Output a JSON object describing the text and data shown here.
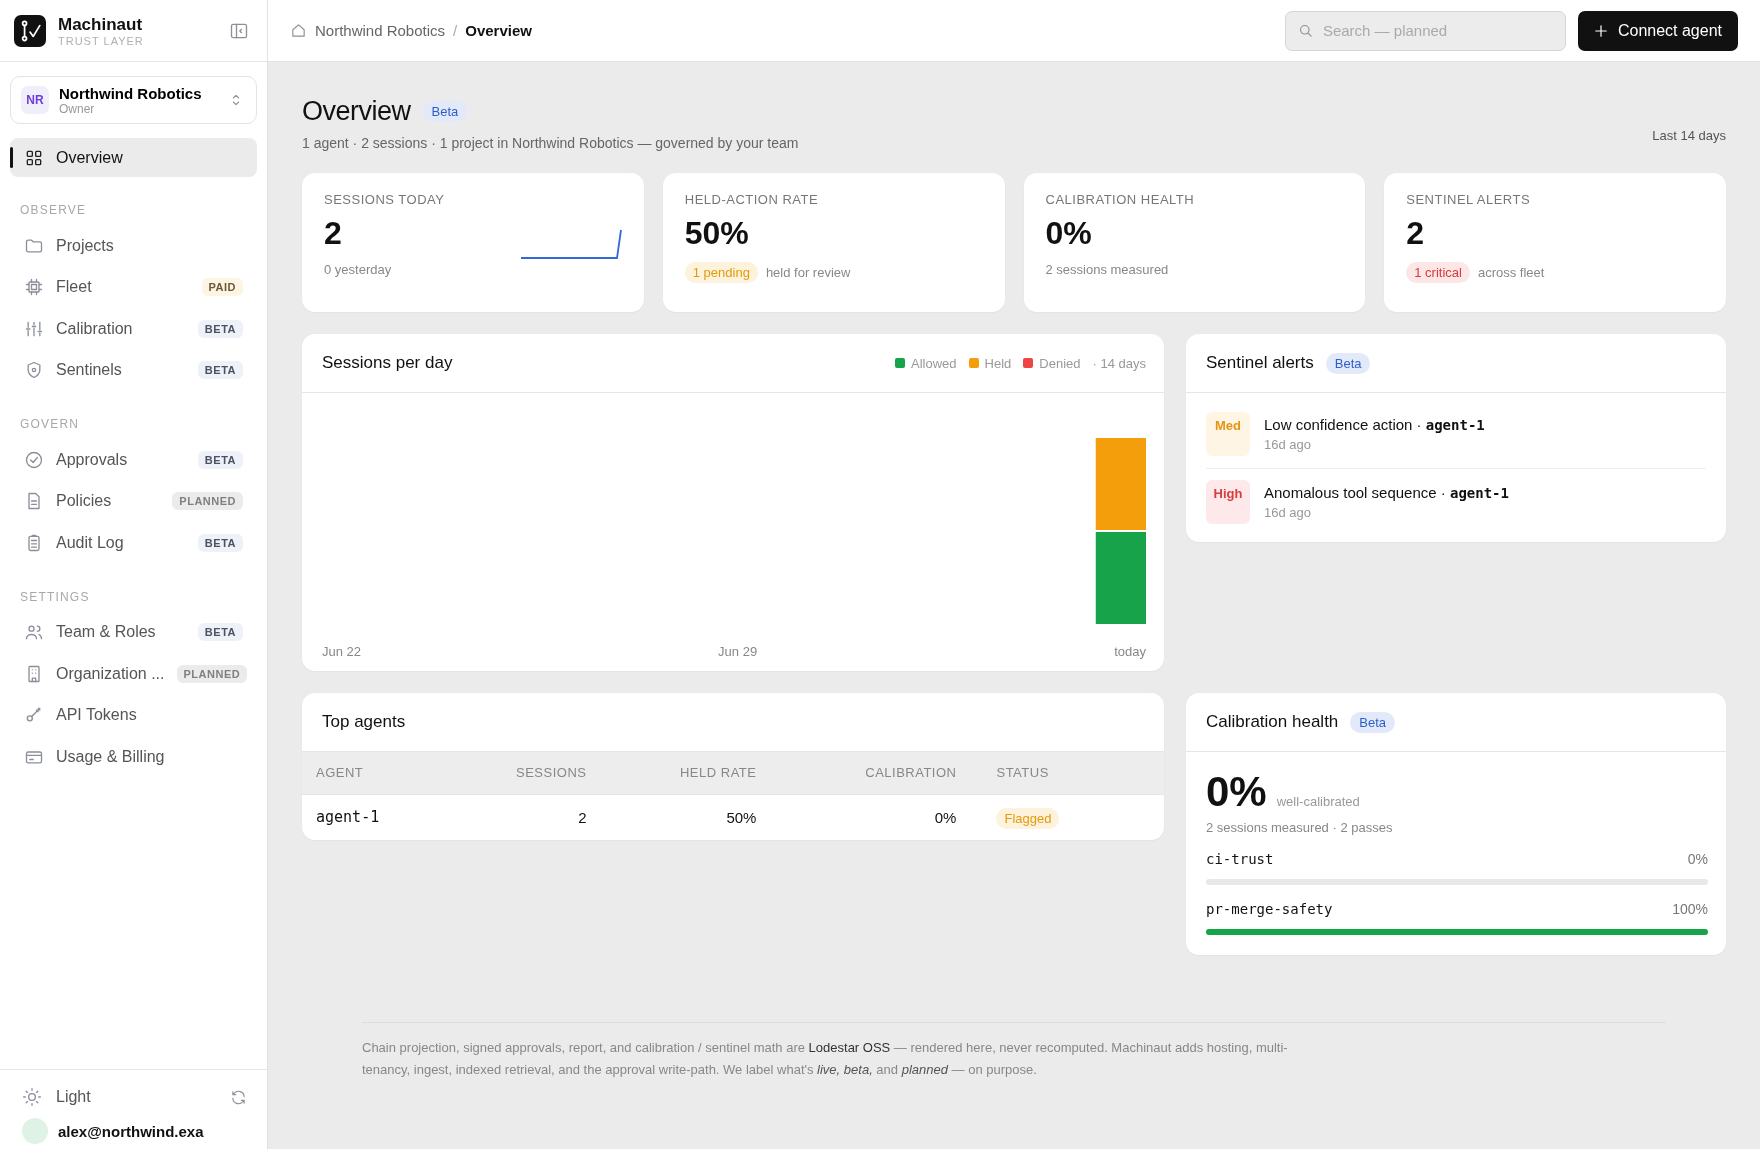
{
  "brand": {
    "name": "Machinaut",
    "tagline": "TRUST LAYER"
  },
  "org": {
    "initials": "NR",
    "name": "Northwind Robotics",
    "role": "Owner"
  },
  "sidebar": {
    "items": [
      {
        "label": "Overview",
        "selected": true
      }
    ],
    "sections": [
      {
        "title": "OBSERVE",
        "items": [
          {
            "label": "Projects",
            "selected": false
          },
          {
            "label": "Fleet",
            "selected": false,
            "badge": {
              "text": "PAID",
              "kind": "paid"
            }
          },
          {
            "label": "Calibration",
            "selected": false,
            "badge": {
              "text": "BETA",
              "kind": "beta"
            }
          },
          {
            "label": "Sentinels",
            "selected": false,
            "badge": {
              "text": "BETA",
              "kind": "beta"
            }
          }
        ]
      },
      {
        "title": "GOVERN",
        "items": [
          {
            "label": "Approvals",
            "selected": false,
            "badge": {
              "text": "BETA",
              "kind": "beta"
            }
          },
          {
            "label": "Policies",
            "selected": false,
            "badge": {
              "text": "PLANNED",
              "kind": "planned"
            }
          },
          {
            "label": "Audit Log",
            "selected": false,
            "badge": {
              "text": "BETA",
              "kind": "beta"
            }
          }
        ]
      },
      {
        "title": "SETTINGS",
        "items": [
          {
            "label": "Team & Roles",
            "selected": false,
            "badge": {
              "text": "BETA",
              "kind": "beta"
            }
          },
          {
            "label": "Organization ...",
            "selected": false,
            "badge": {
              "text": "PLANNED",
              "kind": "planned"
            }
          },
          {
            "label": "API Tokens",
            "selected": false
          },
          {
            "label": "Usage & Billing",
            "selected": false
          }
        ]
      }
    ]
  },
  "theme": {
    "label": "Light"
  },
  "user": {
    "email": "alex@northwind.exa"
  },
  "breadcrumb": {
    "items": [
      "Northwind Robotics",
      "Overview"
    ],
    "separator": "/"
  },
  "search": {
    "placeholder": "Search — planned"
  },
  "connect_button": "Connect agent",
  "header": {
    "title": "Overview",
    "badge": "Beta",
    "subtitle": "1 agent · 2 sessions · 1 project in Northwind Robotics — governed by your team",
    "range": "Last 14 days"
  },
  "kpis": [
    {
      "kind": "sparkline",
      "label": "SESSIONS TODAY",
      "value": "2",
      "note": "0 yesterday"
    },
    {
      "kind": "pill",
      "label": "HELD-ACTION RATE",
      "value": "50%",
      "pill": {
        "text": "1 pending",
        "kind": "warn"
      },
      "note": "held for review"
    },
    {
      "kind": "plain",
      "label": "CALIBRATION HEALTH",
      "value": "0%",
      "note": "2 sessions measured"
    },
    {
      "kind": "pill",
      "label": "SENTINEL ALERTS",
      "value": "2",
      "pill": {
        "text": "1 critical",
        "kind": "danger"
      },
      "note": "across fleet"
    }
  ],
  "sessions_chart": {
    "title": "Sessions per day",
    "legend": [
      {
        "label": "Allowed",
        "color": "#16a34a"
      },
      {
        "label": "Held",
        "color": "#f59e0b"
      },
      {
        "label": "Denied",
        "color": "#ef4444"
      }
    ],
    "range": "· 14 days",
    "x_labels": [
      "Jun 22",
      "Jun 29",
      "today"
    ]
  },
  "sentinel_alerts": {
    "title": "Sentinel alerts",
    "badge": "Beta",
    "items": [
      {
        "severity": {
          "text": "Med",
          "kind": "med"
        },
        "title": "Low confidence action · ",
        "agent": "agent-1",
        "time": "16d ago"
      },
      {
        "severity": {
          "text": "High",
          "kind": "high"
        },
        "title": "Anomalous tool sequence · ",
        "agent": "agent-1",
        "time": "16d ago"
      }
    ]
  },
  "top_agents": {
    "title": "Top agents",
    "columns": [
      "AGENT",
      "SESSIONS",
      "HELD RATE",
      "CALIBRATION",
      "STATUS"
    ],
    "rows": [
      {
        "agent": "agent-1",
        "sessions": "2",
        "held_rate": "50%",
        "calibration": "0%",
        "status": {
          "text": "Flagged",
          "kind": "flagged"
        }
      }
    ]
  },
  "calibration": {
    "title": "Calibration health",
    "badge": "Beta",
    "value": "0%",
    "value_label": "well-calibrated",
    "note": "2 sessions measured · 2 passes",
    "meters": [
      {
        "name": "ci-trust",
        "reading": "0%",
        "level": 0
      },
      {
        "name": "pr-merge-safety",
        "reading": "100%",
        "level": 1
      }
    ]
  },
  "footer": "Chain projection, signed approvals, report, and calibration / sentinel math are **Lodestar OSS** — rendered here, never recomputed. Machinaut adds hosting, multi-tenancy, ingest, indexed retrieval, and the approval write-path. We label what's *live, beta,* and *planned* — on purpose."
}
